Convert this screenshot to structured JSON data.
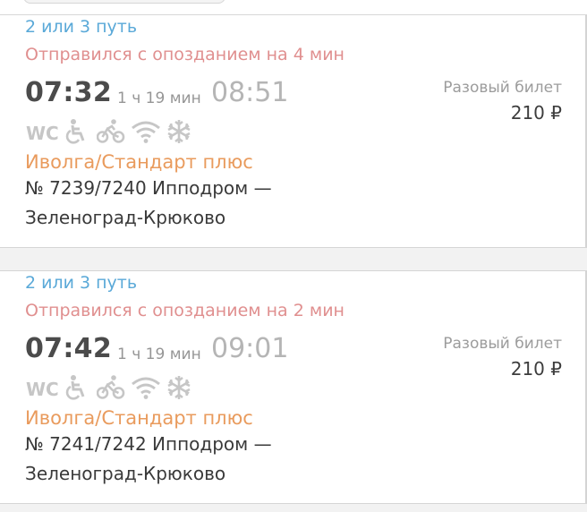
{
  "trips": [
    {
      "track": "2 или 3 путь",
      "status": "Отправился с опозданием на 4 мин",
      "departure": "07:32",
      "duration": "1 ч 19 мин",
      "arrival": "08:51",
      "ticket_type": "Разовый билет",
      "price": "210 ₽",
      "amenities": [
        "wc-icon",
        "wheelchair-icon",
        "bicycle-icon",
        "wifi-icon",
        "snowflake-icon"
      ],
      "train_class": "Иволга/Стандарт плюс",
      "route_line_1": "№ 7239/7240 Ипподром —",
      "route_line_2": "Зеленоград-Крюково"
    },
    {
      "track": "2 или 3 путь",
      "status": "Отправился с опозданием на 2 мин",
      "departure": "07:42",
      "duration": "1 ч 19 мин",
      "arrival": "09:01",
      "ticket_type": "Разовый билет",
      "price": "210 ₽",
      "amenities": [
        "wc-icon",
        "wheelchair-icon",
        "bicycle-icon",
        "wifi-icon",
        "snowflake-icon"
      ],
      "train_class": "Иволга/Стандарт плюс",
      "route_line_1": "№ 7241/7242 Ипподром —",
      "route_line_2": "Зеленоград-Крюково"
    }
  ],
  "colors": {
    "track": "#5aa9d8",
    "status": "#e08f8f",
    "time_departure": "#4b4b4b",
    "time_arrival": "#b5b5b5",
    "duration": "#969696",
    "train_class": "#e99b5d",
    "route": "#3a3a3a",
    "ticket_type": "#9c9c9c",
    "price": "#3d3d3d",
    "amenities": "#c6c6c6"
  }
}
